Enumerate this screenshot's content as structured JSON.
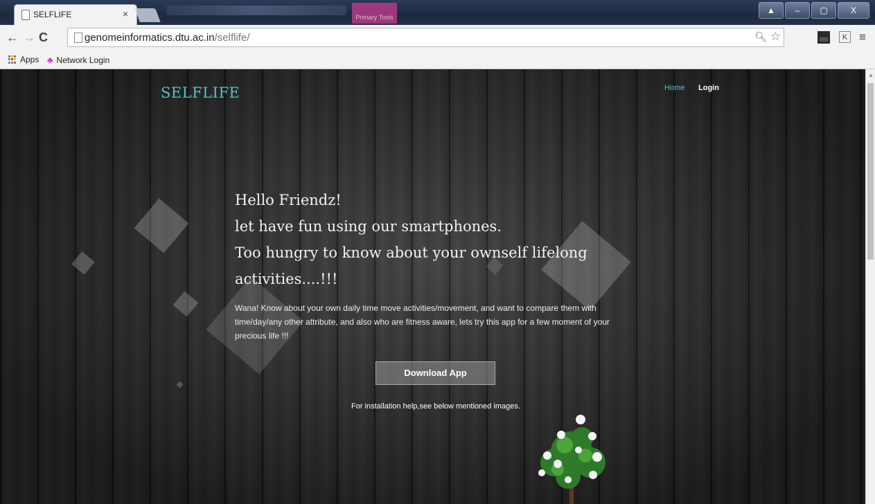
{
  "browser": {
    "tab_title": "SELFLIFE",
    "tab_close": "×",
    "url_host": "genomeinformatics.dtu.ac.in",
    "url_path": "/selflife/",
    "window_buttons": [
      "▲",
      "–",
      "▢",
      "X"
    ],
    "bookmarks": [
      "Apps",
      "Network Login"
    ],
    "extension_label": "K",
    "blurred_tab_label": "Primary Tools"
  },
  "site": {
    "brand": "SELFLIFE",
    "nav": {
      "home": "Home",
      "login": "Login"
    },
    "headline_lines": [
      "Hello Friendz!",
      "let have fun using our smartphones.",
      "Too hungry to know about your ownself lifelong",
      "activities....!!!"
    ],
    "intro": "Wana! Know about your own daily time move activities/movement, and want to compare them with time/day/any other attribute, and also who are fitness aware, lets try this app for a few moment of your precious life !!!",
    "download_label": "Download App",
    "help_text": "For installation help,see below mentioned images.",
    "colors": {
      "accent": "#4fc3c9",
      "text": "#f2f2f2"
    }
  }
}
